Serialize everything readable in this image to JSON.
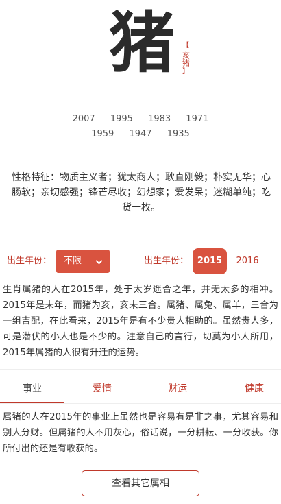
{
  "hero": {
    "character": "猪",
    "seal_text": "亥猪",
    "seal_open": "【",
    "seal_close": "】"
  },
  "years": {
    "row1": [
      "2007",
      "1995",
      "1983",
      "1971"
    ],
    "row2": [
      "1959",
      "1947",
      "1935"
    ]
  },
  "traits": "性格特征：物质主义者；犹太商人；耿直刚毅；朴实无华；心肠软；亲切感强；锋芒尽收；幻想家；爱发呆；迷糊单纯；吃货一枚。",
  "filters": {
    "left_label": "出生年份：",
    "select_value": "不限",
    "right_label": "出生年份：",
    "active_year": "2015",
    "other_year": "2016"
  },
  "overview": "生肖属猪的人在2015年，处于太岁遥合之年，并无太多的相冲。2015年是未年，而猪为亥，亥未三合。属猪、属兔、属羊，三合为一组吉配，在此看来，2015年是有不少贵人相助的。虽然贵人多，可是潜伏的小人也是不少的。注意自己的言行，切莫为小人所用，2015年属猪的人很有升迁的运势。",
  "tabs": [
    "事业",
    "爱情",
    "财运",
    "健康"
  ],
  "active_tab": "事业",
  "tab_content": "属猪的人在2015年的事业上虽然也是容易有是非之事，尤其容易和别人分财。但属猪的人不用灰心，俗话说，一分耕耘、一分收获。你所付出的还是有收获的。",
  "more_button": "查看其它属相",
  "colors": {
    "accent": "#d9533f",
    "accent_text": "#c0392b",
    "text": "#333333"
  }
}
